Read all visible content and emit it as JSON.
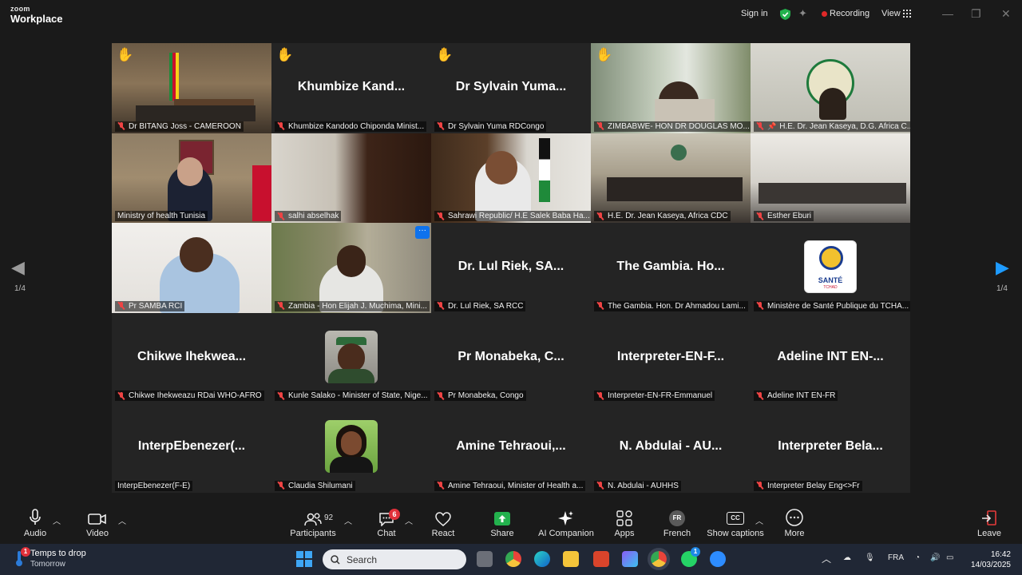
{
  "app": {
    "logo_line1": "zoom",
    "logo_line2": "Workplace"
  },
  "titlebar": {
    "sign_in": "Sign in",
    "recording": "Recording",
    "view": "View"
  },
  "gallery": {
    "tiles": [
      {
        "label": "Dr BITANG Joss - CAMEROON",
        "big": "",
        "hand": true
      },
      {
        "label": "Khumbize Kandodo Chiponda Minist...",
        "big": "Khumbize  Kand...",
        "hand": true
      },
      {
        "label": "Dr Sylvain Yuma  RDCongo",
        "big": "Dr Sylvain  Yuma...",
        "hand": true
      },
      {
        "label": "ZIMBABWE- HON DR DOUGLAS MO...",
        "big": "",
        "hand": true
      },
      {
        "label": "H.E. Dr. Jean Kaseya, D.G. Africa C...",
        "big": "",
        "hand": false
      },
      {
        "label": "Ministry of health Tunisia",
        "big": "",
        "hand": false
      },
      {
        "label": "salhi abselhak",
        "big": "",
        "hand": false
      },
      {
        "label": "Sahrawi Republic/ H.E Salek Baba Ha...",
        "big": "",
        "hand": false
      },
      {
        "label": "H.E. Dr. Jean Kaseya, Africa CDC",
        "big": "",
        "hand": false
      },
      {
        "label": "Esther Eburi",
        "big": "",
        "hand": false
      },
      {
        "label": "Pr SAMBA RCI",
        "big": "",
        "hand": false
      },
      {
        "label": "Zambia - Hon Elijah J. Muchima, Mini...",
        "big": "",
        "hand": false
      },
      {
        "label": "Dr. Lul Riek, SA RCC",
        "big": "Dr. Lul  Riek,  SA...",
        "hand": false
      },
      {
        "label": "The Gambia. Hon. Dr Ahmadou Lami...",
        "big": "The  Gambia.  Ho...",
        "hand": false
      },
      {
        "label": "Ministère de Santé Publique du TCHA...",
        "big": "",
        "hand": false
      },
      {
        "label": "Chikwe Ihekweazu RDai WHO-AFRO",
        "big": "Chikwe  Ihekwea...",
        "hand": false
      },
      {
        "label": "Kunle Salako - Minister of State, Nige...",
        "big": "",
        "hand": false
      },
      {
        "label": "Pr Monabeka, Congo",
        "big": "Pr  Monabeka,  C...",
        "hand": false
      },
      {
        "label": "Interpreter-EN-FR-Emmanuel",
        "big": "Interpreter-EN-F...",
        "hand": false
      },
      {
        "label": "Adeline INT EN-FR",
        "big": "Adeline  INT  EN-...",
        "hand": false
      },
      {
        "label": "InterpEbenezer(F-E)",
        "big": "InterpEbenezer(...",
        "hand": false
      },
      {
        "label": "Claudia Shilumani",
        "big": "",
        "hand": false
      },
      {
        "label": "Amine Tehraoui, Minister of Health a...",
        "big": "Amine  Tehraoui,...",
        "hand": false
      },
      {
        "label": "N. Abdulai - AUHHS",
        "big": "N.  Abdulai  -  AU...",
        "hand": false
      },
      {
        "label": "Interpreter Belay Eng<>Fr",
        "big": "Interpreter  Bela...",
        "hand": false
      }
    ],
    "sante_logo": {
      "text": "SANTÉ",
      "sub": "TCHAD"
    },
    "more_btn": "···"
  },
  "nav": {
    "left_page": "1/4",
    "right_page": "1/4"
  },
  "toolbar": {
    "audio": "Audio",
    "video": "Video",
    "participants": "Participants",
    "participants_count": "92",
    "chat": "Chat",
    "chat_badge": "6",
    "react": "React",
    "share": "Share",
    "ai_companion": "AI Companion",
    "apps": "Apps",
    "french": "French",
    "french_badge": "FR",
    "show_captions": "Show captions",
    "cc": "CC",
    "more": "More",
    "leave": "Leave"
  },
  "taskbar": {
    "weather_title": "Temps to drop",
    "weather_sub": "Tomorrow",
    "weather_badge": "1",
    "search": "Search",
    "whatsapp_badge": "1",
    "lang": "FRA",
    "time": "16:42",
    "date": "14/03/2025"
  },
  "colors": {
    "active_speaker": "#2fd46b",
    "share_green": "#23b14d",
    "recording_red": "#e02828",
    "accent_blue": "#0e72ed"
  }
}
